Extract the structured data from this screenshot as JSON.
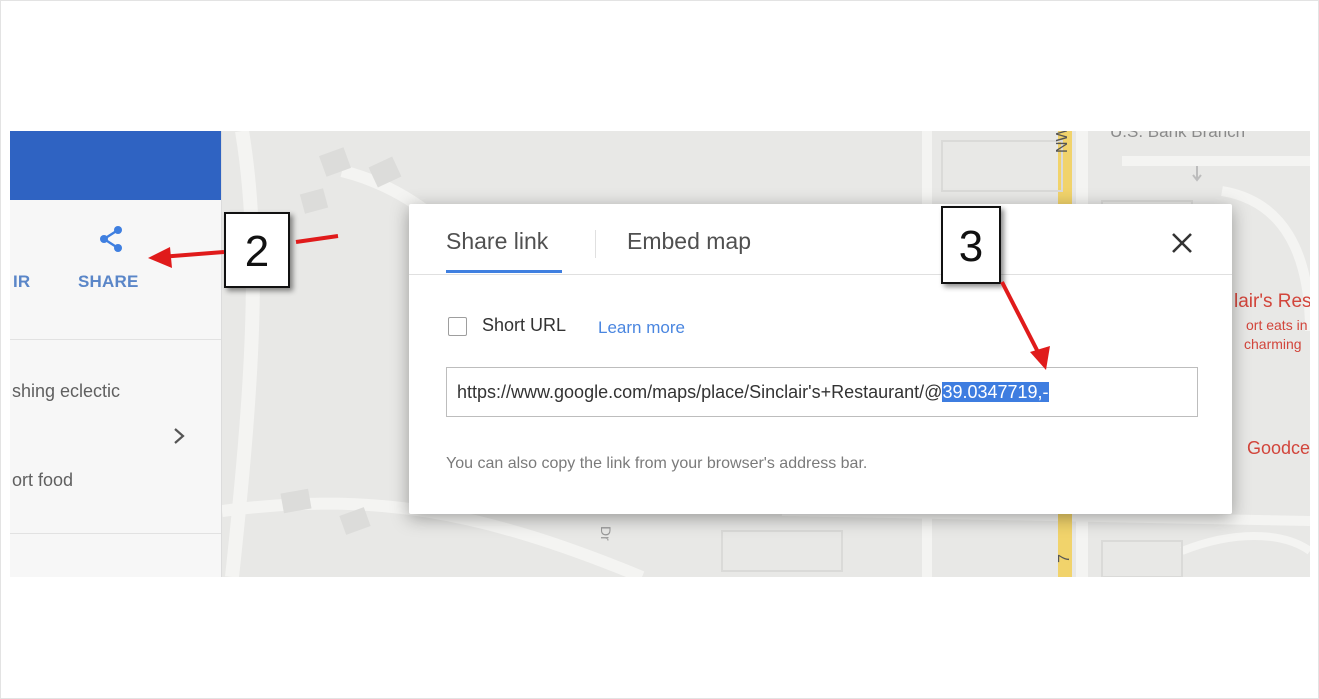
{
  "panel": {
    "tour_label_fragment": "IR",
    "share_label": "SHARE",
    "description_line1": "shing eclectic",
    "description_line2": "ort food"
  },
  "map": {
    "bank_label": "U.S. Bank Branch",
    "road_label": "NW H",
    "road_number": "7",
    "side_road": "Dr",
    "restaurant_name": "lair's Res",
    "restaurant_desc1": "ort eats in",
    "restaurant_desc2": "charming",
    "other_place": "Goodce"
  },
  "dialog": {
    "tabs": [
      {
        "label": "Share link",
        "active": true
      },
      {
        "label": "Embed map",
        "active": false
      }
    ],
    "short_url_label": "Short URL",
    "learn_more": "Learn more",
    "url_prefix": "https://www.google.com/maps/place/Sinclair's+Restaurant/@",
    "url_selected": "39.0347719,-",
    "hint": "You can also copy the link from your browser's address bar."
  },
  "annotations": {
    "step2": "2",
    "step3": "3"
  },
  "colors": {
    "header_blue": "#2f63c2",
    "accent_blue": "#3f7fe0",
    "link_blue": "#4a86e0",
    "selection_blue": "#3e7de0",
    "arrow_red": "#e01b1b",
    "restaurant_red": "#d2453b"
  }
}
